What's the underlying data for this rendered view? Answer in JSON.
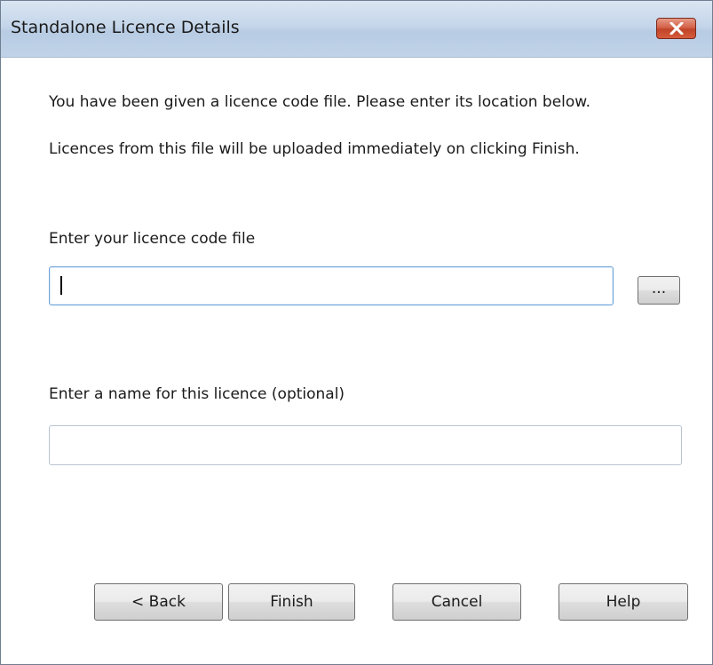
{
  "window": {
    "title": "Standalone Licence Details",
    "close_icon": "close-icon"
  },
  "intro": {
    "line1": "You have been given a licence code file. Please enter its location below.",
    "line2": "Licences from this file will be uploaded immediately on clicking Finish."
  },
  "licence_file": {
    "label": "Enter your licence code file",
    "value": "",
    "browse_label": "..."
  },
  "licence_name": {
    "label": "Enter a name for this licence (optional)",
    "value": ""
  },
  "buttons": {
    "back": "< Back",
    "finish": "Finish",
    "cancel": "Cancel",
    "help": "Help"
  },
  "colors": {
    "title_bar": "#c5d6ea",
    "close_button": "#c8503a",
    "focus_border": "#6fa3d9"
  }
}
